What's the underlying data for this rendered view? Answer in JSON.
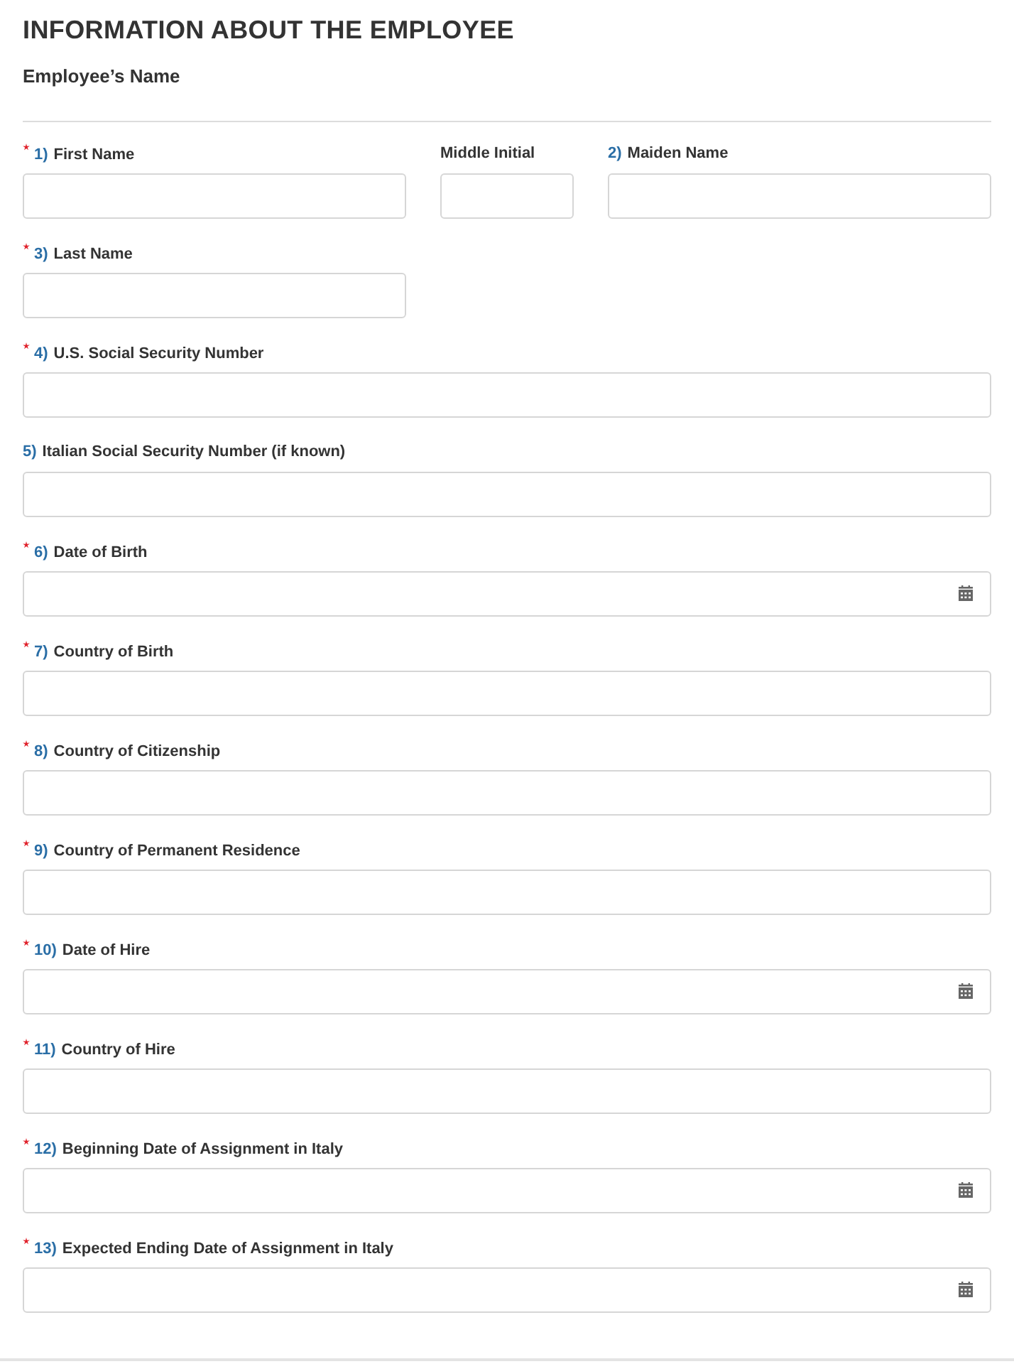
{
  "title": "INFORMATION ABOUT THE EMPLOYEE",
  "subtitle": "Employee’s Name",
  "rows": [
    {
      "fields": [
        {
          "required": true,
          "number": "1)",
          "label": "First Name",
          "kind": "text"
        },
        {
          "required": false,
          "label": "Middle Initial",
          "kind": "text"
        },
        {
          "required": false,
          "number": "2)",
          "label": "Maiden Name",
          "kind": "text"
        }
      ]
    },
    {
      "fields": [
        {
          "required": true,
          "number": "3)",
          "label": "Last Name",
          "kind": "short"
        }
      ]
    },
    {
      "fields": [
        {
          "required": true,
          "number": "4)",
          "label": "U.S. Social Security Number",
          "kind": "text"
        }
      ]
    },
    {
      "fields": [
        {
          "required": false,
          "number": "5)",
          "label": "Italian Social Security Number (if known)",
          "kind": "text"
        }
      ]
    },
    {
      "fields": [
        {
          "required": true,
          "number": "6)",
          "label": "Date of Birth",
          "kind": "date"
        }
      ]
    },
    {
      "fields": [
        {
          "required": true,
          "number": "7)",
          "label": "Country of Birth",
          "kind": "text"
        }
      ]
    },
    {
      "fields": [
        {
          "required": true,
          "number": "8)",
          "label": "Country of Citizenship",
          "kind": "text"
        }
      ]
    },
    {
      "fields": [
        {
          "required": true,
          "number": "9)",
          "label": "Country of Permanent Residence",
          "kind": "text"
        }
      ]
    },
    {
      "fields": [
        {
          "required": true,
          "number": "10)",
          "label": "Date of Hire",
          "kind": "date"
        }
      ]
    },
    {
      "fields": [
        {
          "required": true,
          "number": "11)",
          "label": "Country of Hire",
          "kind": "text"
        }
      ]
    },
    {
      "fields": [
        {
          "required": true,
          "number": "12)",
          "label": "Beginning Date of Assignment in Italy",
          "kind": "date"
        }
      ]
    },
    {
      "fields": [
        {
          "required": true,
          "number": "13)",
          "label": "Expected Ending Date of Assignment in Italy",
          "kind": "date"
        }
      ]
    }
  ]
}
